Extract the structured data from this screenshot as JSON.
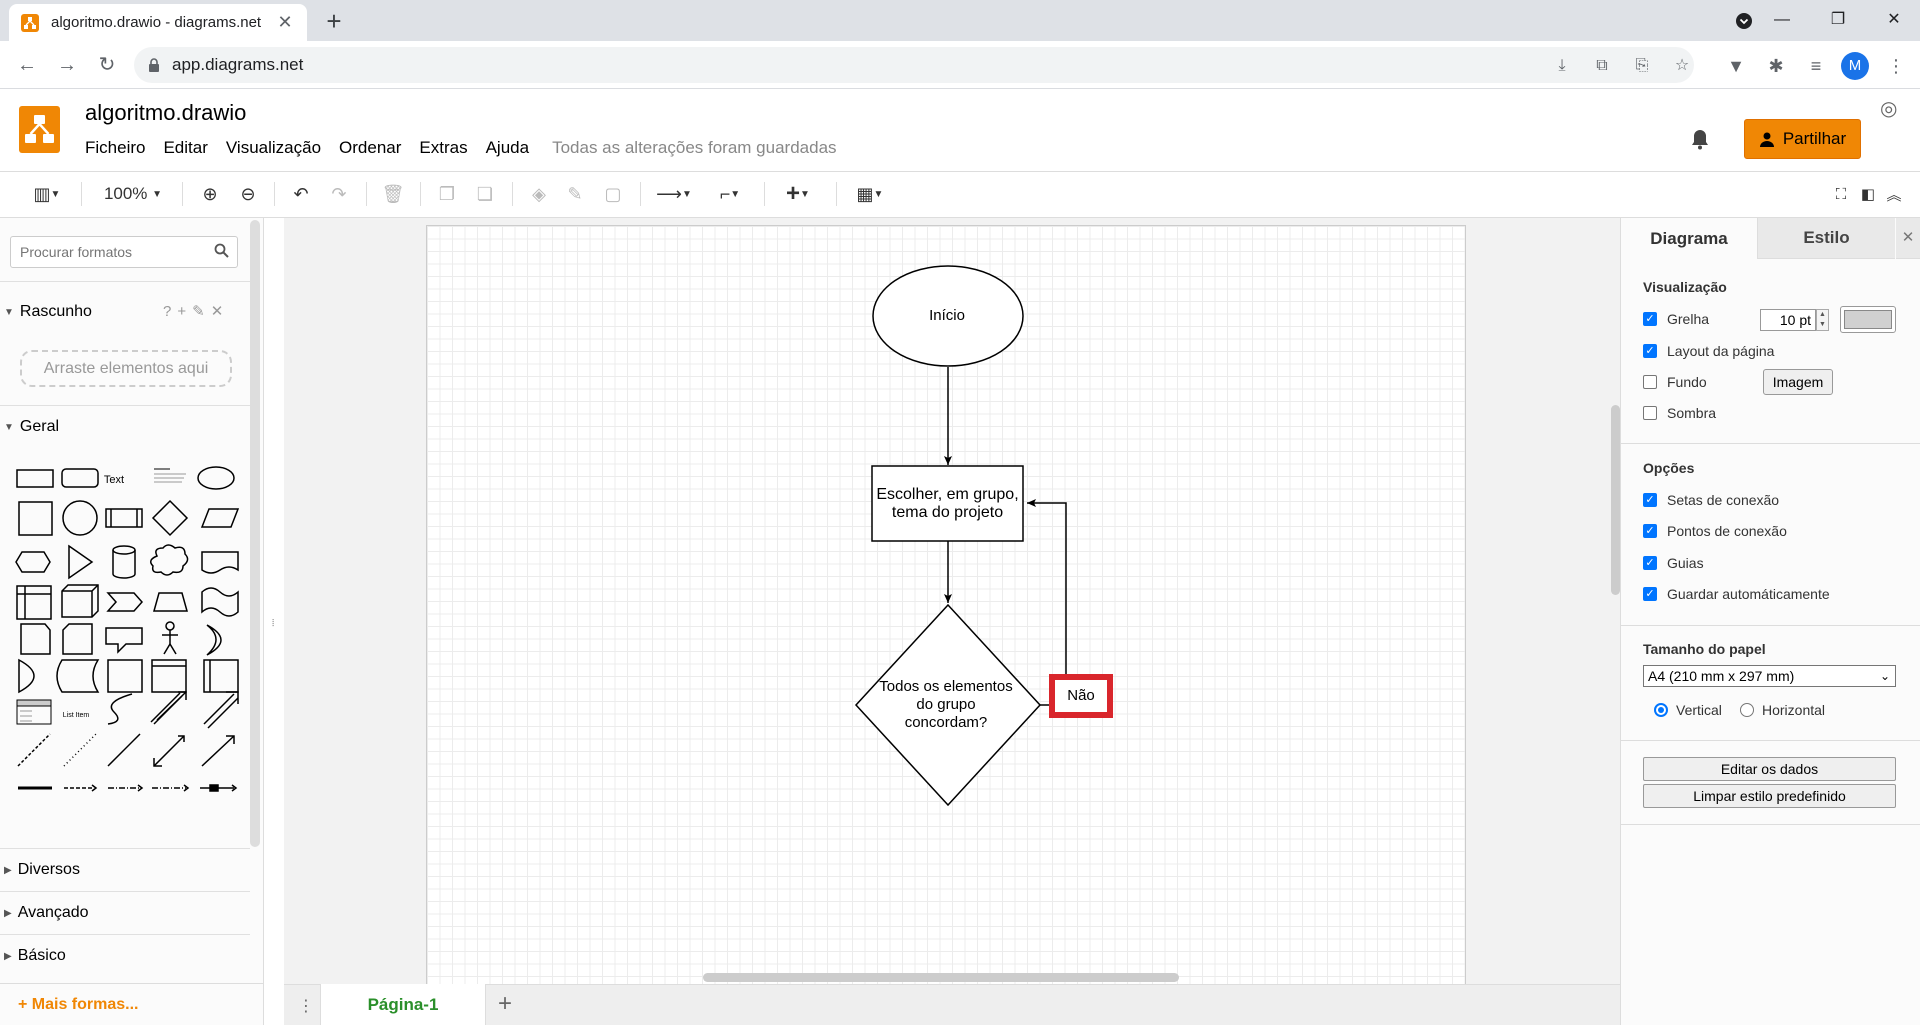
{
  "browser": {
    "tab_title": "algoritmo.drawio - diagrams.net",
    "new_tab": "+",
    "url": "app.diagrams.net",
    "profile_initial": "M"
  },
  "app": {
    "doc_title": "algoritmo.drawio",
    "menus": [
      "Ficheiro",
      "Editar",
      "Visualização",
      "Ordenar",
      "Extras",
      "Ajuda"
    ],
    "save_status": "Todas as alterações foram guardadas",
    "share_label": "Partilhar"
  },
  "toolbar": {
    "zoom": "100%"
  },
  "left_panel": {
    "search_placeholder": "Procurar formatos",
    "scratchpad_title": "Rascunho",
    "scratchpad_drop": "Arraste elementos aqui",
    "general_title": "Geral",
    "shape_text": "Text",
    "shape_list_item": "List Item",
    "collapsed_sections": [
      "Diversos",
      "Avançado",
      "Básico"
    ],
    "more_shapes": "+ Mais formas..."
  },
  "diagram": {
    "start": "Início",
    "process_line1": "Escolher, em grupo,",
    "process_line2": "tema do projeto",
    "decision_line1": "Todos os elementos",
    "decision_line2": "do grupo",
    "decision_line3": "concordam?",
    "edge_label": "Não",
    "highlight_color": "#d9262c"
  },
  "pages": {
    "current": "Página-1",
    "add": "+"
  },
  "right_panel": {
    "tabs": [
      "Diagrama",
      "Estilo"
    ],
    "view_heading": "Visualização",
    "grid": "Grelha",
    "grid_size": "10 pt",
    "page_layout": "Layout da página",
    "background": "Fundo",
    "image_button": "Imagem",
    "shadow": "Sombra",
    "options_heading": "Opções",
    "options": [
      "Setas de conexão",
      "Pontos de conexão",
      "Guias",
      "Guardar automáticamente"
    ],
    "paper_heading": "Tamanho do papel",
    "paper_size": "A4 (210 mm x 297 mm)",
    "portrait": "Vertical",
    "landscape": "Horizontal",
    "edit_data": "Editar os dados",
    "clear_style": "Limpar estilo predefinido"
  },
  "colors": {
    "accent": "#f08705",
    "checkbox": "#0075ff",
    "page_tab_text": "#2a8f2a"
  }
}
